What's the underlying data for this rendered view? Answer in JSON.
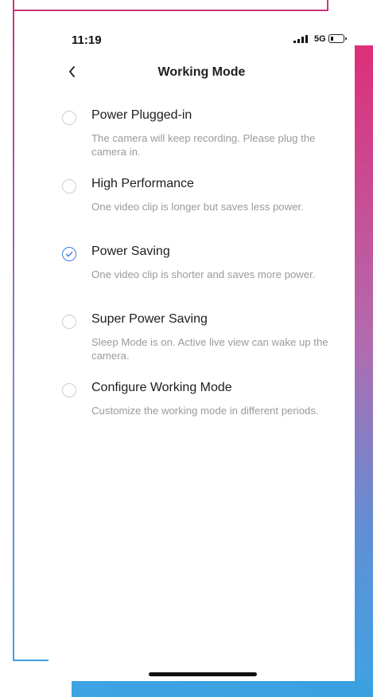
{
  "status_bar": {
    "time": "11:19",
    "network": "5G"
  },
  "header": {
    "title": "Working Mode",
    "back_icon": "chevron-left-icon"
  },
  "options": [
    {
      "label": "Power Plugged-in",
      "description": "The camera will keep recording. Please plug the camera in.",
      "selected": false
    },
    {
      "label": "High Performance",
      "description": "One video clip is longer but saves less power.",
      "selected": false
    },
    {
      "label": "Power Saving",
      "description": "One video clip is shorter and saves more power.",
      "selected": true
    },
    {
      "label": "Super Power Saving",
      "description": "Sleep Mode is on. Active live view can wake up the camera.",
      "selected": false
    },
    {
      "label": "Configure Working Mode",
      "description": "Customize the working mode in different periods.",
      "selected": false
    }
  ],
  "colors": {
    "accent": "#3d7ee6",
    "frame_pink": "#dd2f79",
    "frame_blue": "#3ea3e2"
  }
}
